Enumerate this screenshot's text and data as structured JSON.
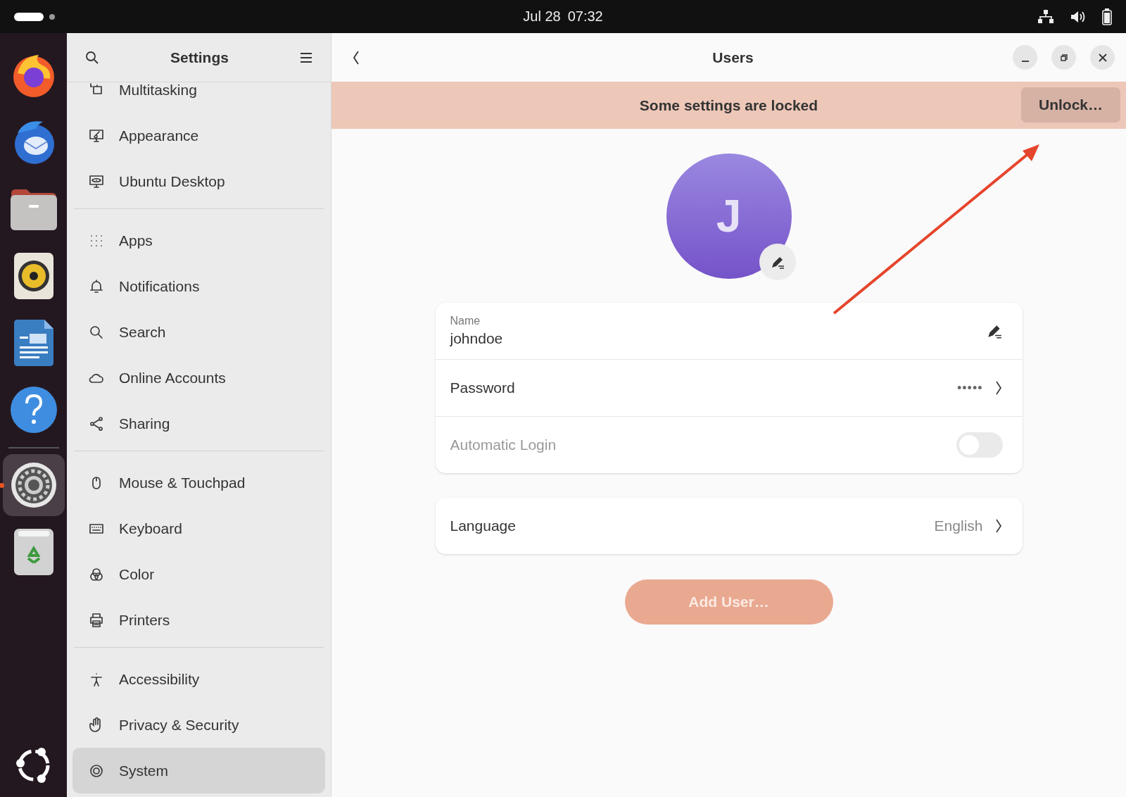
{
  "top_bar": {
    "date": "Jul 28",
    "time": "07:32"
  },
  "dock": {
    "items": [
      {
        "kind": "firefox",
        "active": false
      },
      {
        "kind": "mail",
        "active": false
      },
      {
        "kind": "files",
        "active": false
      },
      {
        "kind": "speaker",
        "active": false
      },
      {
        "kind": "writer",
        "active": false
      },
      {
        "kind": "help",
        "active": false
      },
      {
        "kind": "settings",
        "active": true
      },
      {
        "kind": "trash",
        "active": false
      }
    ]
  },
  "sidebar": {
    "title": "Settings",
    "groups": [
      [
        {
          "label": "Multitasking",
          "kind": "multitasking",
          "selected": false
        },
        {
          "label": "Appearance",
          "kind": "appearance",
          "selected": false
        },
        {
          "label": "Ubuntu Desktop",
          "kind": "desktop",
          "selected": false
        }
      ],
      [
        {
          "label": "Apps",
          "kind": "apps",
          "selected": false
        },
        {
          "label": "Notifications",
          "kind": "bell",
          "selected": false
        },
        {
          "label": "Search",
          "kind": "search",
          "selected": false
        },
        {
          "label": "Online Accounts",
          "kind": "cloud",
          "selected": false
        },
        {
          "label": "Sharing",
          "kind": "share",
          "selected": false
        }
      ],
      [
        {
          "label": "Mouse & Touchpad",
          "kind": "mouse",
          "selected": false
        },
        {
          "label": "Keyboard",
          "kind": "keyboard",
          "selected": false
        },
        {
          "label": "Color",
          "kind": "color",
          "selected": false
        },
        {
          "label": "Printers",
          "kind": "printer",
          "selected": false
        }
      ],
      [
        {
          "label": "Accessibility",
          "kind": "person",
          "selected": false
        },
        {
          "label": "Privacy & Security",
          "kind": "hand",
          "selected": false
        },
        {
          "label": "System",
          "kind": "gear",
          "selected": true
        }
      ]
    ]
  },
  "header": {
    "title": "Users"
  },
  "banner": {
    "message": "Some settings are locked",
    "button": "Unlock…"
  },
  "avatar": {
    "initial": "J"
  },
  "account_rows": [
    {
      "kind": "name",
      "label": "Name",
      "value": "johndoe"
    },
    {
      "kind": "password",
      "label": "Password",
      "value": "•••••"
    },
    {
      "kind": "switch",
      "label": "Automatic Login",
      "on": false,
      "disabled": true
    }
  ],
  "language_row": {
    "label": "Language",
    "value": "English"
  },
  "add_user_button": {
    "label": "Add User…",
    "disabled": true
  }
}
